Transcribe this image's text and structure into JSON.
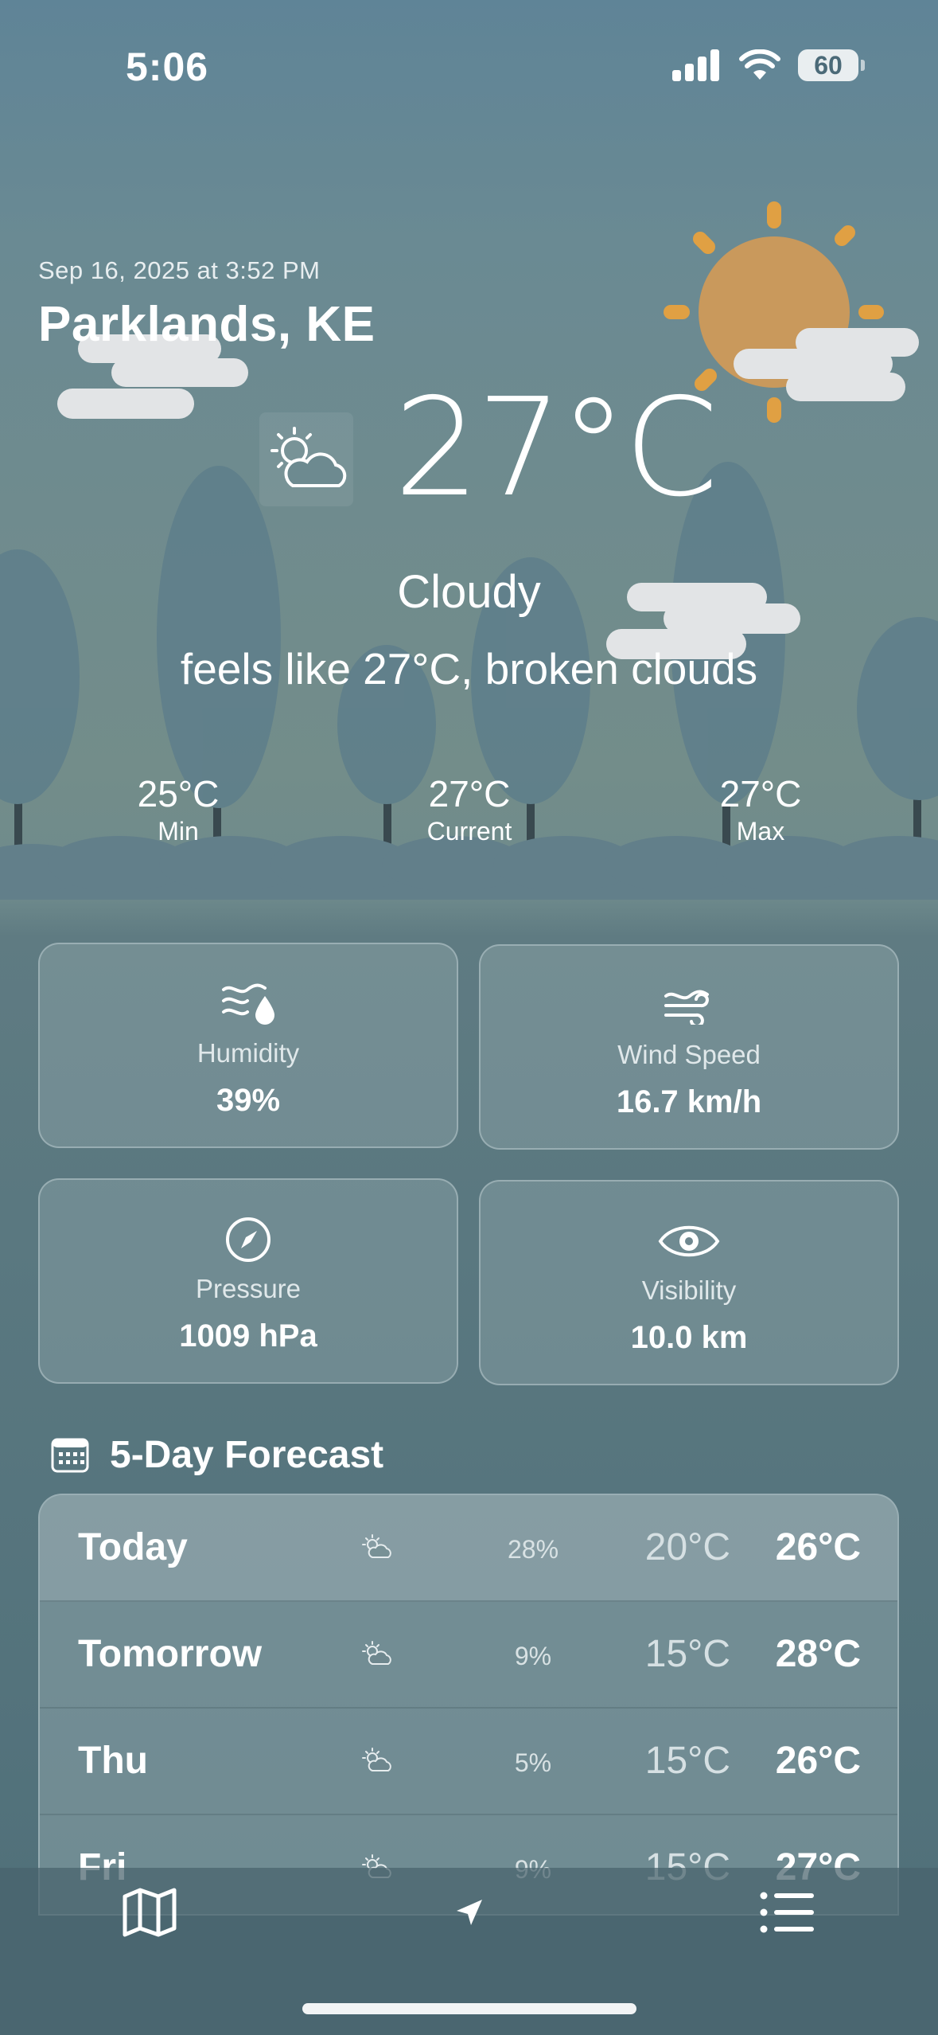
{
  "status_bar": {
    "time": "5:06",
    "battery": "60"
  },
  "weather": {
    "date": "Sep 16, 2025 at 3:52 PM",
    "location": "Parklands, KE",
    "temperature": "27°C",
    "condition": "Cloudy",
    "feels_like": "feels like 27°C, broken clouds",
    "condition_icon": "partly-cloudy-icon"
  },
  "min_max": [
    {
      "value": "25°C",
      "label": "Min"
    },
    {
      "value": "27°C",
      "label": "Current"
    },
    {
      "value": "27°C",
      "label": "Max"
    }
  ],
  "metrics": [
    {
      "label": "Humidity",
      "value": "39%",
      "icon": "humidity-icon"
    },
    {
      "label": "Wind Speed",
      "value": "16.7 km/h",
      "icon": "wind-icon"
    },
    {
      "label": "Pressure",
      "value": "1009 hPa",
      "icon": "gauge-icon"
    },
    {
      "label": "Visibility",
      "value": "10.0 km",
      "icon": "eye-icon"
    }
  ],
  "forecast": {
    "title": "5-Day Forecast",
    "icon": "calendar-icon",
    "days": [
      {
        "day": "Today",
        "pop": "28%",
        "low": "20°C",
        "high": "26°C"
      },
      {
        "day": "Tomorrow",
        "pop": "9%",
        "low": "15°C",
        "high": "28°C"
      },
      {
        "day": "Thu",
        "pop": "5%",
        "low": "15°C",
        "high": "26°C"
      },
      {
        "day": "Fri",
        "pop": "9%",
        "low": "15°C",
        "high": "27°C"
      }
    ]
  },
  "tab_bar": {
    "items": [
      "map-icon",
      "location-arrow-icon",
      "list-icon"
    ]
  },
  "colors": {
    "sun": "#c9995c",
    "sun_rays": "#e0a043",
    "cloud": "#e2e4e6",
    "tree": "#5e7e8b"
  }
}
